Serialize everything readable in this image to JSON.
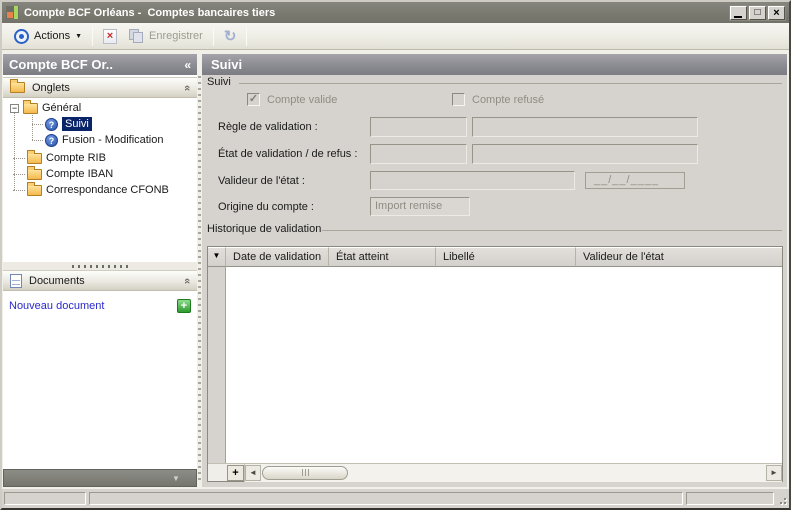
{
  "window": {
    "title": "Compte BCF Orléans -  Comptes bancaires tiers",
    "controls": {
      "minimize": "",
      "maximize": "□",
      "close": "×"
    }
  },
  "toolbar": {
    "actions_label": "Actions",
    "save_label": "Enregistrer"
  },
  "icons": {
    "dropdown_arrow": "▼",
    "collapse_left": "«",
    "collapse_up": "«",
    "tree_expand_minus": "−",
    "help_glyph": "?",
    "delete_glyph": "×",
    "refresh_glyph": "↻",
    "green_plus": "+",
    "filter_arrow": "▼",
    "scroll_left": "◄",
    "scroll_right": "►",
    "bottom_arrow": "▼",
    "check": "✓",
    "add_row": "+"
  },
  "colors": {
    "titlebar_gray": "#7b7b73",
    "panel_header_gray": "#8b8b92",
    "content_gray": "#d6d3ce",
    "selection_navy": "#0a246a",
    "link_blue": "#2929cc",
    "plus_green": "#2f9b2f",
    "delete_red": "#cf2b2b"
  },
  "sidebar": {
    "header_title": "Compte BCF Or..",
    "groups": {
      "onglets": "Onglets",
      "documents": "Documents"
    },
    "tree": [
      {
        "label": "Général"
      },
      {
        "label": "Suivi",
        "selected": true
      },
      {
        "label": "Fusion - Modification"
      },
      {
        "label": "Compte RIB"
      },
      {
        "label": "Compte IBAN"
      },
      {
        "label": "Correspondance CFONB"
      }
    ],
    "documents": {
      "new_link": "Nouveau document"
    }
  },
  "main": {
    "header_title": "Suivi",
    "suivi": {
      "label": "Suivi",
      "checkbox_valide": {
        "label": "Compte valide",
        "checked": true
      },
      "checkbox_refuse": {
        "label": "Compte refusé",
        "checked": false
      },
      "fields": {
        "regle_label": "Règle de validation :",
        "etat_label": "État de validation / de refus :",
        "valideur_label": "Valideur de l'état :",
        "origine_label": "Origine du compte :",
        "origine_value": "Import remise",
        "date_mask": "__/__/____"
      }
    },
    "historique": {
      "label": "Historique de validation",
      "columns": [
        "Date de validation",
        "État atteint",
        "Libellé",
        "Valideur de l'état"
      ],
      "rows": []
    }
  }
}
